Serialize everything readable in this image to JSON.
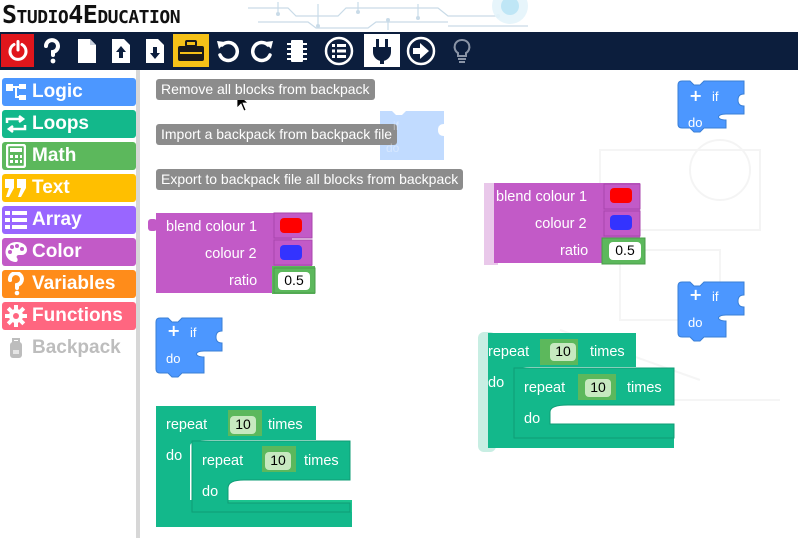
{
  "app": {
    "logo_text": "Studio4Education"
  },
  "toolbar": {
    "buttons": [
      {
        "name": "power-icon"
      },
      {
        "name": "help-icon"
      },
      {
        "name": "new-file-icon"
      },
      {
        "name": "upload-icon"
      },
      {
        "name": "download-icon"
      },
      {
        "name": "toolbox-icon"
      },
      {
        "name": "undo-icon"
      },
      {
        "name": "redo-icon"
      },
      {
        "name": "board-icon"
      },
      {
        "name": "checklist-icon"
      },
      {
        "name": "plug-icon"
      },
      {
        "name": "arrow-right-icon"
      },
      {
        "name": "lightbulb-icon"
      }
    ],
    "colors": {
      "background": "#0c1e3d",
      "power": "#e0161c",
      "active": "#f5c118"
    }
  },
  "sidebar": {
    "categories": [
      {
        "label": "Logic",
        "color": "#4c97ff"
      },
      {
        "label": "Loops",
        "color": "#13b88b"
      },
      {
        "label": "Math",
        "color": "#5cb85c"
      },
      {
        "label": "Text",
        "color": "#ffbf00"
      },
      {
        "label": "Array",
        "color": "#9966ff"
      },
      {
        "label": "Color",
        "color": "#c25ac7"
      },
      {
        "label": "Variables",
        "color": "#ff8c1a"
      },
      {
        "label": "Functions",
        "color": "#ff6680"
      },
      {
        "label": "Backpack",
        "color": "#bdbdbd"
      }
    ]
  },
  "context_menu": {
    "items": [
      "Remove all blocks from backpack",
      "Import a backpack from backpack file",
      "Export to backpack file all blocks from backpack"
    ]
  },
  "blocks": {
    "if": {
      "label_if": "if",
      "label_do": "do",
      "plus": "+"
    },
    "blend": {
      "label_blend": "blend colour 1",
      "label_colour2": "colour 2",
      "label_ratio": "ratio",
      "ratio_value": "0.5",
      "colour1": "#ff0000",
      "colour2": "#3333ff"
    },
    "repeat": {
      "label_repeat": "repeat",
      "label_times": "times",
      "label_do": "do",
      "count": "10"
    }
  }
}
